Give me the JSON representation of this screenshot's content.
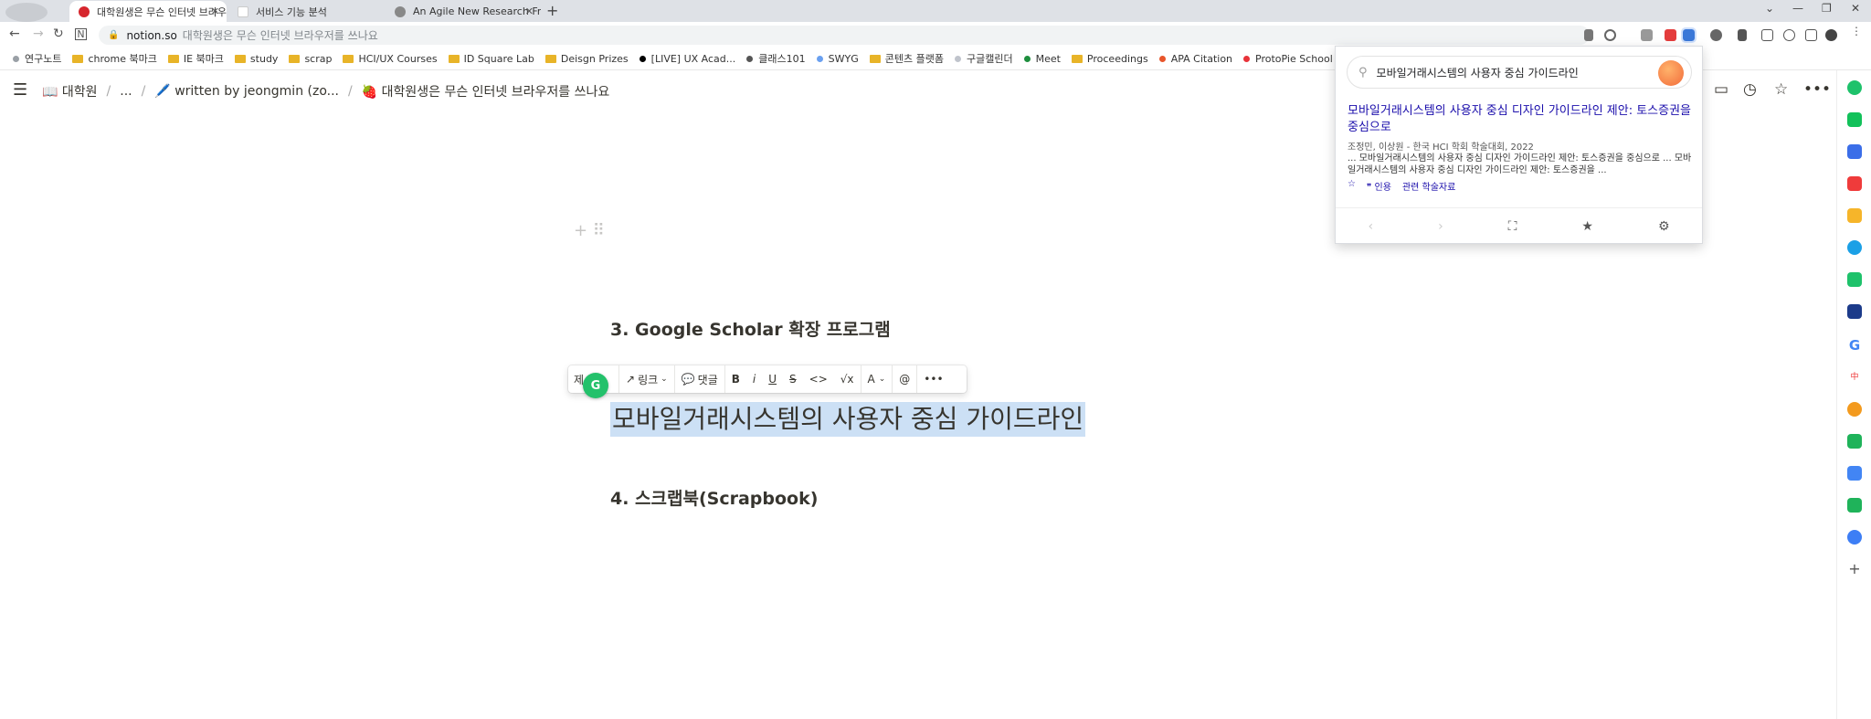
{
  "browser": {
    "tabs": [
      {
        "title": "대학원생은 무슨 인터넷 브라우",
        "active": true
      },
      {
        "title": "서비스 기능 분석",
        "active": false
      },
      {
        "title": "An Agile New Research Frame",
        "active": false
      }
    ],
    "url_host": "notion.so",
    "url_path": "대학원생은 무슨 인터넷 브라우저를 쓰나요",
    "bookmarks": [
      {
        "label": "연구노트",
        "kind": "dot",
        "color": "#9aa0a6"
      },
      {
        "label": "chrome 북마크",
        "kind": "folder"
      },
      {
        "label": "IE 북마크",
        "kind": "folder"
      },
      {
        "label": "study",
        "kind": "folder"
      },
      {
        "label": "scrap",
        "kind": "folder"
      },
      {
        "label": "HCI/UX Courses",
        "kind": "folder"
      },
      {
        "label": "ID Square Lab",
        "kind": "folder"
      },
      {
        "label": "Deisgn Prizes",
        "kind": "folder"
      },
      {
        "label": "[LIVE] UX Acad...",
        "kind": "dot",
        "color": "#000000"
      },
      {
        "label": "클래스101",
        "kind": "dot",
        "color": "#555555"
      },
      {
        "label": "SWYG",
        "kind": "dot",
        "color": "#6aa0f0"
      },
      {
        "label": "콘텐츠 플랫폼",
        "kind": "folder"
      },
      {
        "label": "구글캘린더",
        "kind": "dot",
        "color": "#c0c4cc"
      },
      {
        "label": "Meet",
        "kind": "dot",
        "color": "#1e8e3e"
      },
      {
        "label": "Proceedings",
        "kind": "folder"
      },
      {
        "label": "APA Citation",
        "kind": "dot",
        "color": "#e8552b"
      },
      {
        "label": "ProtoPie School",
        "kind": "dot",
        "color": "#e8333a"
      }
    ]
  },
  "notion": {
    "breadcrumbs": [
      {
        "label": "📖 대학원"
      },
      {
        "label": "..."
      },
      {
        "label": "🖊️ written by jeongmin (zo..."
      },
      {
        "label": "🍓 대학원생은 무슨 인터넷 브라우저를 쓰나요"
      }
    ],
    "breadcrumb_sep": "/",
    "heading_3": "3. Google Scholar 확장 프로그램",
    "selected_text": "모바일거래시스템의 사용자 중심 가이드라인",
    "heading_4": "4. 스크랩북(Scrapbook)",
    "toolbar": {
      "text_type": "제",
      "link": "링크",
      "comment": "댓글",
      "bold": "B",
      "italic": "i",
      "underline": "U",
      "strike": "S",
      "code": "<>",
      "equation": "√x",
      "color": "A",
      "mention": "@",
      "more": "•••"
    },
    "badge": "G"
  },
  "scholar": {
    "query": "모바일거래시스템의 사용자 중심 가이드라인",
    "result_title": "모바일거래시스템의 사용자 중심 디자인 가이드라인 제안: 토스증권을 중심으로",
    "authors": "조정민, 이상원 - 한국 HCI 학회 학술대회, 2022",
    "snippet": "... 모바일거래시스템의 사용자 중심 디자인 가이드라인 제안: 토스증권을 중심으로 ... 모바일거래시스템의 사용자 중심 디자인 가이드라인 제안: 토스증권을 ...",
    "cite_label": "인용",
    "related_label": "관련 학술자료"
  }
}
